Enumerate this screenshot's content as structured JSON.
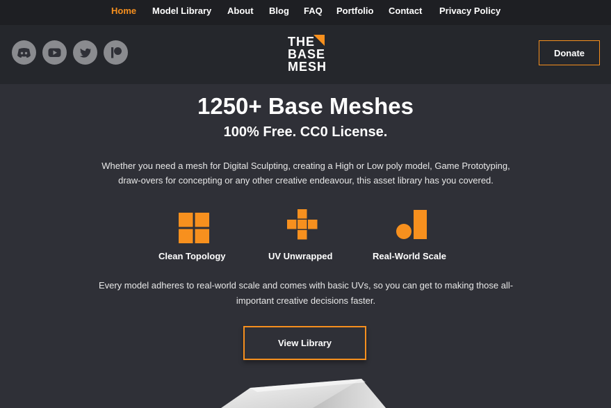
{
  "nav": {
    "items": [
      {
        "label": "Home",
        "active": true
      },
      {
        "label": "Model Library"
      },
      {
        "label": "About"
      },
      {
        "label": "Blog"
      },
      {
        "label": "FAQ"
      },
      {
        "label": "Portfolio"
      },
      {
        "label": "Contact"
      },
      {
        "label": "Privacy Policy"
      }
    ]
  },
  "header": {
    "social": [
      "discord-icon",
      "youtube-icon",
      "twitter-icon",
      "patreon-icon"
    ],
    "logo": {
      "line1": "THE",
      "line2": "BASE",
      "line3": "MESH"
    },
    "donate_label": "Donate"
  },
  "hero": {
    "title": "1250+ Base Meshes",
    "subtitle": "100% Free. CC0 License.",
    "intro": "Whether you need a mesh for Digital Sculpting, creating a High or Low poly model, Game Prototyping, draw-overs for concepting or any other creative endeavour, this asset library has you covered."
  },
  "features": [
    {
      "icon": "grid-icon",
      "label": "Clean Topology"
    },
    {
      "icon": "cross-icon",
      "label": "UV Unwrapped"
    },
    {
      "icon": "scale-icon",
      "label": "Real-World Scale"
    }
  ],
  "description": "Every model adheres to real-world scale and comes with basic UVs, so you can get to making those all-important creative decisions faster.",
  "cta": {
    "label": "View Library"
  },
  "colors": {
    "accent": "#f7901e",
    "background": "#2f3037",
    "topbar": "#1e1f23",
    "header": "#25272c"
  }
}
